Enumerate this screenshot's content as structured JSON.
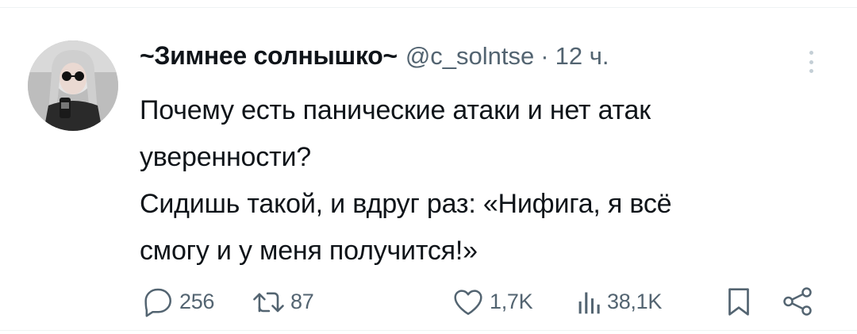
{
  "tweet": {
    "display_name": "~Зимнее солнышко~",
    "handle": "@c_solntse",
    "separator": "·",
    "timestamp": "12 ч.",
    "text_lines": [
      "Почему есть панические атаки и нет атак",
      "уверенности?",
      "Сидишь такой, и вдруг раз: «Нифига, я всё",
      "смогу и у меня получится!»"
    ]
  },
  "actions": {
    "replies": "256",
    "reposts": "87",
    "likes": "1,7K",
    "views": "38,1K"
  },
  "icons": {
    "reply": "reply-icon",
    "repost": "repost-icon",
    "like": "heart-icon",
    "views": "bar-chart-icon",
    "bookmark": "bookmark-icon",
    "share": "share-icon",
    "more": "more-vertical-icon"
  },
  "colors": {
    "text_primary": "#0f1419",
    "text_secondary": "#536471",
    "more_dots": "#c4cfd6",
    "divider": "#eff3f4"
  }
}
